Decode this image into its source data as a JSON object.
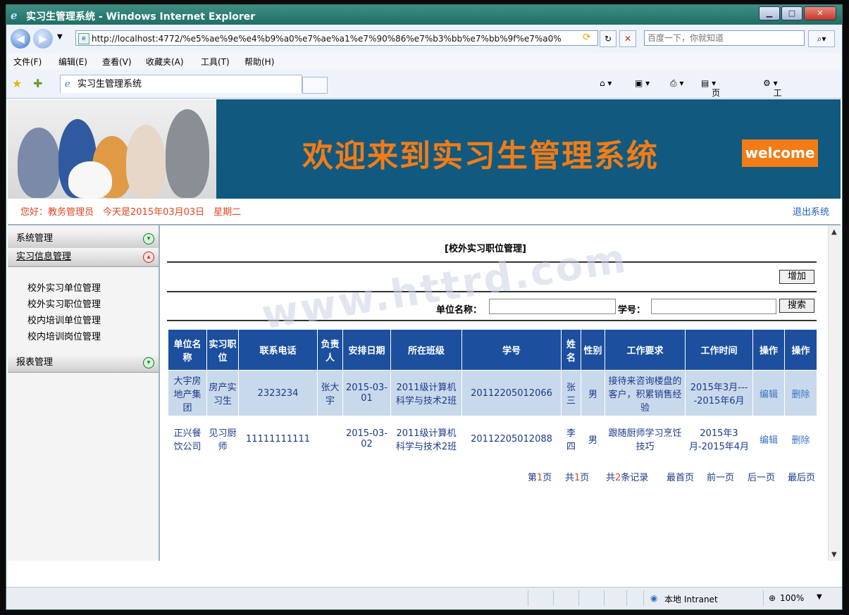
{
  "window": {
    "title": "实习生管理系统 - Windows Internet Explorer",
    "minimize": "▁",
    "maximize": "□",
    "close": "✕"
  },
  "address": {
    "url": "http://localhost:4772/%e5%ae%9e%e4%b9%a0%e7%ae%a1%e7%90%86%e7%b3%bb%e7%bb%9f%e7%a0%",
    "search_placeholder": "百度一下，你就知道"
  },
  "menu": [
    "文件(F)",
    "编辑(E)",
    "查看(V)",
    "收藏夹(A)",
    "工具(T)",
    "帮助(H)"
  ],
  "tab": {
    "label": "实习生管理系统"
  },
  "toolbar": {
    "page": "页面(P)",
    "tools": "工具(O)"
  },
  "banner": {
    "title": "欢迎来到实习生管理系统",
    "button": "welcome"
  },
  "info": {
    "greeting": "您好：教务管理员　今天是2015年03月03日　星期二",
    "logout": "退出系统"
  },
  "sidebar": {
    "sections": [
      "系统管理",
      "实习信息管理",
      "报表管理"
    ],
    "items": [
      "校外实习单位管理",
      "校外实习职位管理",
      "校内培训单位管理",
      "校内培训岗位管理"
    ]
  },
  "main": {
    "title": "[校外实习职位管理]",
    "add_button": "增加",
    "unit_label": "单位名称：",
    "student_label": "学号：",
    "search_button": "搜索",
    "columns": [
      "单位名称",
      "实习职位",
      "联系电话",
      "负责人",
      "安排日期",
      "所在班级",
      "学号",
      "姓名",
      "性别",
      "工作要求",
      "工作时间",
      "操作",
      "操作"
    ],
    "rows": [
      [
        "大宇房地产集团",
        "房产实习生",
        "2323234",
        "张大宇",
        "2015-03-01",
        "2011级计算机科学与技术2班",
        "20112205012066",
        "张三",
        "男",
        "接待来咨询楼盘的客户，积累销售经验",
        "2015年3月----2015年6月",
        "编辑",
        "删除"
      ],
      [
        "正兴餐饮公司",
        "见习厨师",
        "11111111111",
        "",
        "2015-03-02",
        "2011级计算机科学与技术2班",
        "20112205012088",
        "李四",
        "男",
        "跟随厨师学习烹饪技巧",
        "2015年3月-2015年4月",
        "编辑",
        "删除"
      ]
    ],
    "pager": {
      "page_prefix": "第",
      "page_num": "1",
      "page_suffix": "页",
      "total_prefix": "共",
      "total_pages": "1",
      "total_suffix": "页",
      "rec_prefix": "共",
      "records": "2",
      "rec_suffix": "条记录",
      "first": "最首页",
      "prev": "前一页",
      "next": "后一页",
      "last": "最后页"
    }
  },
  "watermark": "www.httrd.com",
  "status": {
    "zone": "本地 Intranet",
    "zoom": "100%"
  },
  "colors": {
    "banner": "#11597f",
    "accent": "#f27c15",
    "header": "#1c4f9e",
    "row_alt": "#c9d9ec"
  }
}
